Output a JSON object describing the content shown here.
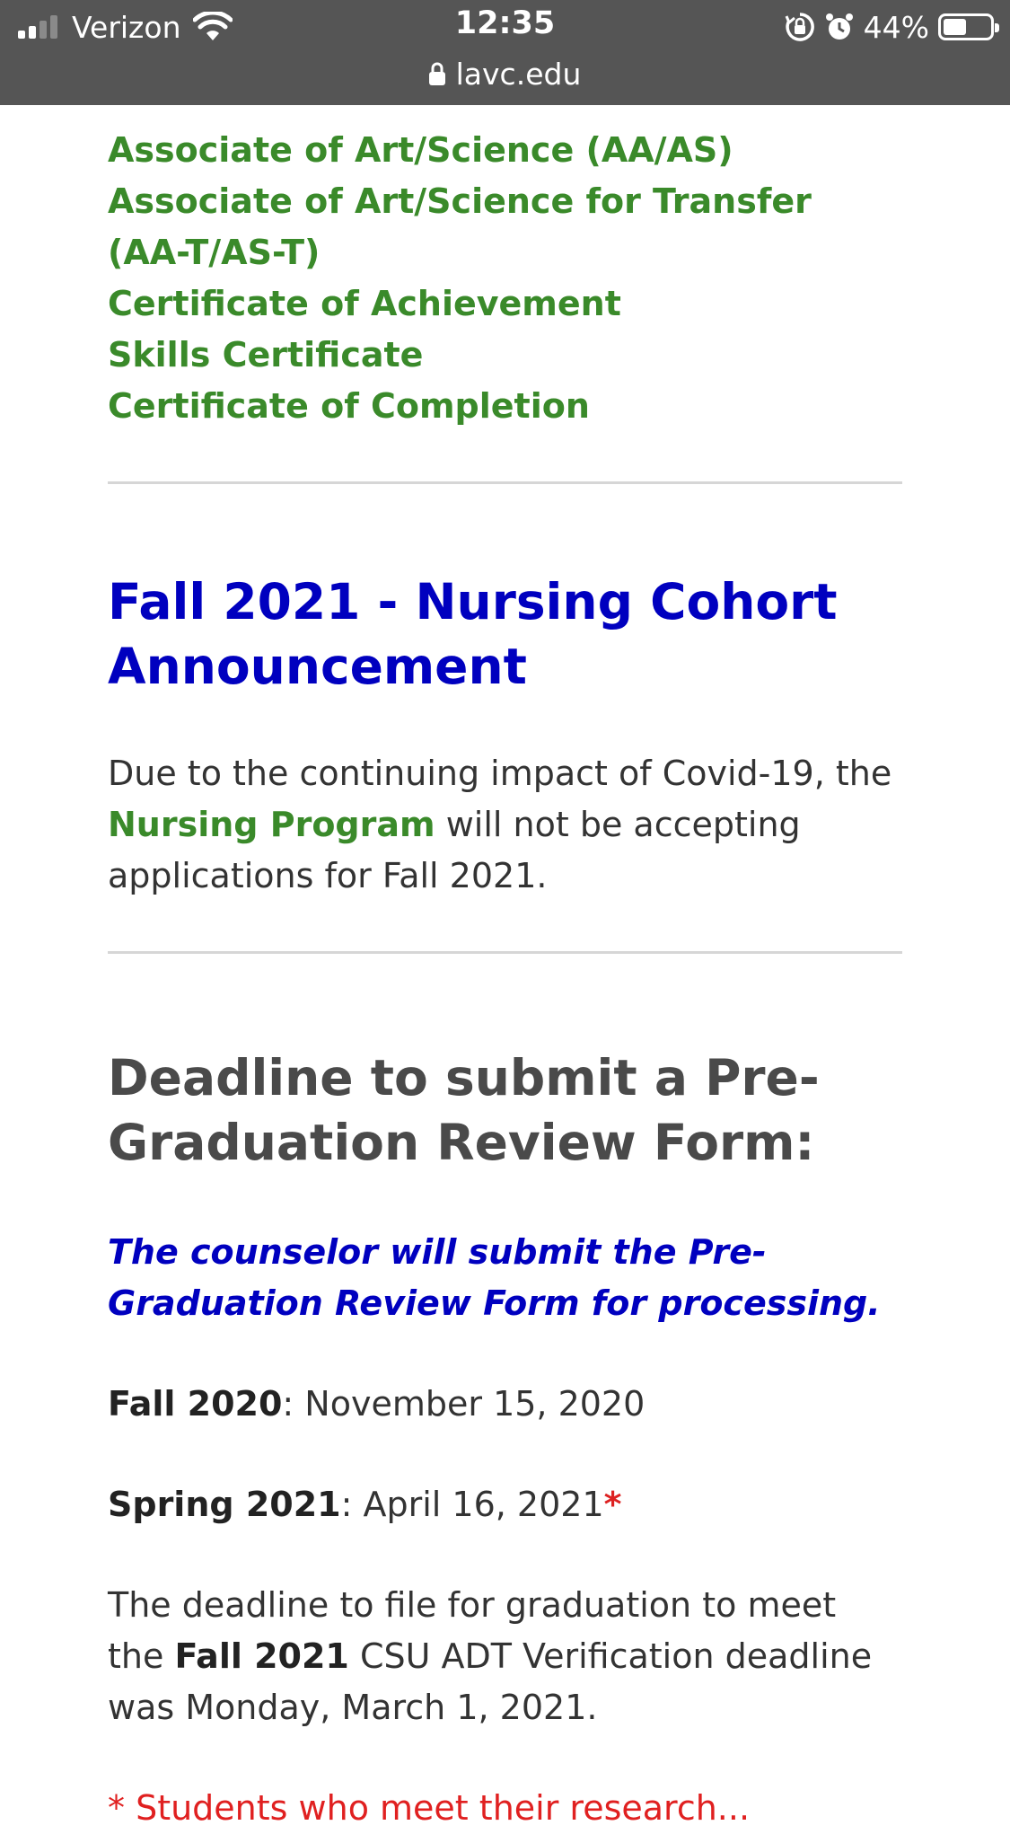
{
  "status_bar": {
    "carrier": "Verizon",
    "time": "12:35",
    "battery_percent_label": "44%",
    "battery_level": 0.44,
    "url": "lavc.edu"
  },
  "degree_links": [
    "Associate of Art/Science (AA/AS)",
    "Associate of Art/Science for Transfer (AA-T/AS-T)",
    "Certificate of Achievement",
    "Skills Certificate",
    "Certificate of Completion"
  ],
  "nursing": {
    "heading": "Fall 2021 - Nursing Cohort Announcement",
    "text_before": "Due to the continuing impact of Covid-19, the ",
    "link": "Nursing Program",
    "text_after": " will not be accepting applications for Fall 2021."
  },
  "deadline": {
    "heading": "Deadline to submit a Pre-Graduation Review Form:",
    "note": "The counselor will submit the Pre-Graduation Review Form for processing.",
    "fall_term": "Fall 2020",
    "fall_date": ": November 15, 2020",
    "spring_term": "Spring 2021",
    "spring_date": ": April 16, 2021",
    "asterisk": "*",
    "para_before": "The deadline to file for graduation to meet the ",
    "para_term": "Fall 2021",
    "para_after": " CSU ADT Verification deadline was Monday, March 1, 2021.",
    "footnote_partial": "* Students who meet their research..."
  },
  "colors": {
    "status_bg": "#555555",
    "link_green": "#3a8a2a",
    "heading_blue": "#0000bf",
    "asterisk_red": "#dd2222"
  }
}
